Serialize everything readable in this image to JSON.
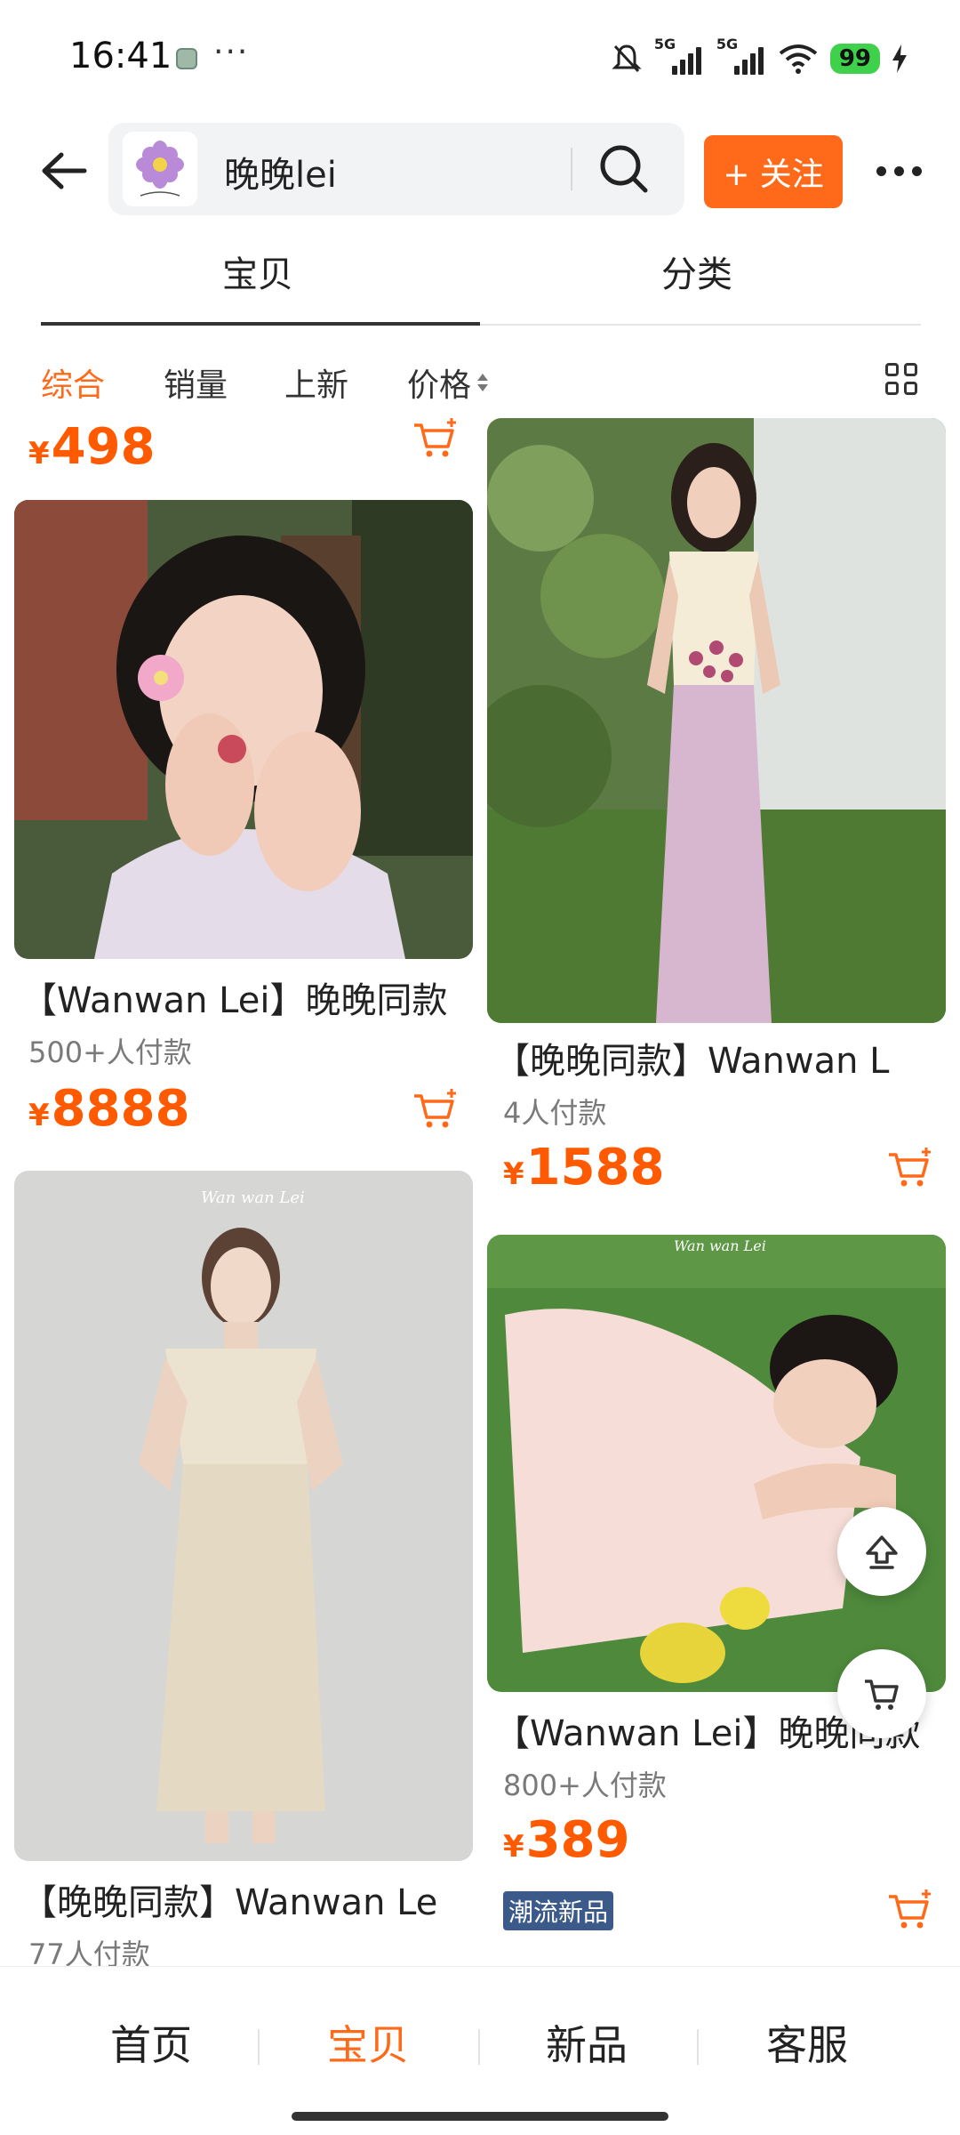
{
  "status": {
    "time": "16:41",
    "dots": "···",
    "net1": "5G",
    "net2": "5G",
    "battery": "99"
  },
  "header": {
    "search_text": "晚晚lei",
    "follow_label": "+ 关注"
  },
  "tabs": {
    "items": "宝贝",
    "category": "分类"
  },
  "sort": {
    "overall": "综合",
    "sales": "销量",
    "new": "上新",
    "price": "价格"
  },
  "products": {
    "top_left": {
      "currency": "¥",
      "price": "498"
    },
    "left1": {
      "title": "【Wanwan Lei】晚晚同款",
      "sales": "500+人付款",
      "currency": "¥",
      "price": "8888"
    },
    "right1": {
      "title": "【晚晚同款】Wanwan L",
      "sales": "4人付款",
      "currency": "¥",
      "price": "1588"
    },
    "left2": {
      "title": "【晚晚同款】Wanwan Le",
      "sales": "77人付款"
    },
    "right2": {
      "title": "【Wanwan Lei】晚晚同款",
      "sales": "800+人付款",
      "currency": "¥",
      "price": "389",
      "badge": "潮流新品"
    }
  },
  "bottom_nav": {
    "home": "首页",
    "items": "宝贝",
    "new": "新品",
    "service": "客服"
  },
  "colors": {
    "accent": "#ff6a1a",
    "price": "#ff5a00",
    "badge": "#3b5a8a"
  }
}
